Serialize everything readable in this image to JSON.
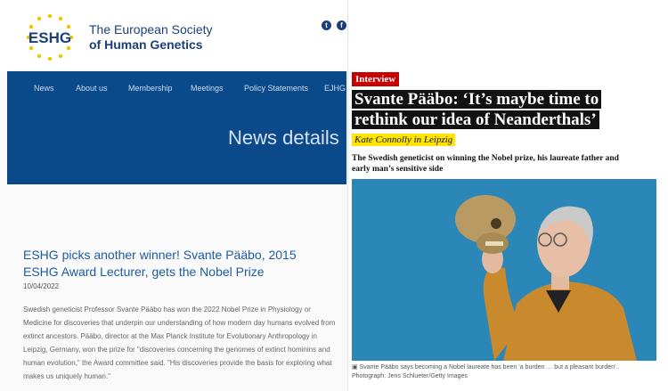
{
  "left": {
    "logo": {
      "abbr": "ESHG",
      "line1": "The European Society",
      "line2": "of Human Genetics"
    },
    "social": [
      {
        "icon": "twitter-icon",
        "glyph": "t"
      },
      {
        "icon": "facebook-icon",
        "glyph": "f"
      }
    ],
    "nav": [
      "News",
      "About us",
      "Membership",
      "Meetings",
      "Policy Statements",
      "EJHG"
    ],
    "banner_title": "News details",
    "article": {
      "title": "ESHG picks another winner! Svante Pääbo, 2015 ESHG Award Lecturer, gets the Nobel Prize",
      "date": "10/04/2022",
      "body": "Swedish geneticist Professor Svante Pääbo has won the 2022 Nobel Prize in Physiology or Medicine for discoveries that underpin our understanding of how modern day humans evolved from extinct ancestors. Pääbo, director at the Max Planck Institute for Evolutionary Anthropology in Leipzig, Germany, won the prize for \"discoveries concerning the genomes of extinct hominins and human evolution,\" the Award committee said. \"His discoveries provide the basis for exploring what makes us uniquely human.\""
    }
  },
  "right": {
    "tag": "Interview",
    "headline_line1": "Svante Pääbo: ‘It’s maybe time to",
    "headline_line2": "rethink our idea of Neanderthals’",
    "byline": "Kate Connolly in Leipzig",
    "standfirst": "The Swedish geneticist on winning the Nobel prize, his laureate father and early man’s sensitive side",
    "caption_line1": "Svante Pääbo says becoming a Nobel laureate has been ‘a burden … but a pleasant burden’.",
    "caption_line2": "Photograph: Jens Schlueter/Getty Images"
  },
  "colors": {
    "eshg_blue": "#0b4a8a",
    "link_blue": "#1c5ba3",
    "guardian_red": "#c70000",
    "byline_yellow": "#ffe500",
    "photo_bg": "#2a87b8"
  }
}
